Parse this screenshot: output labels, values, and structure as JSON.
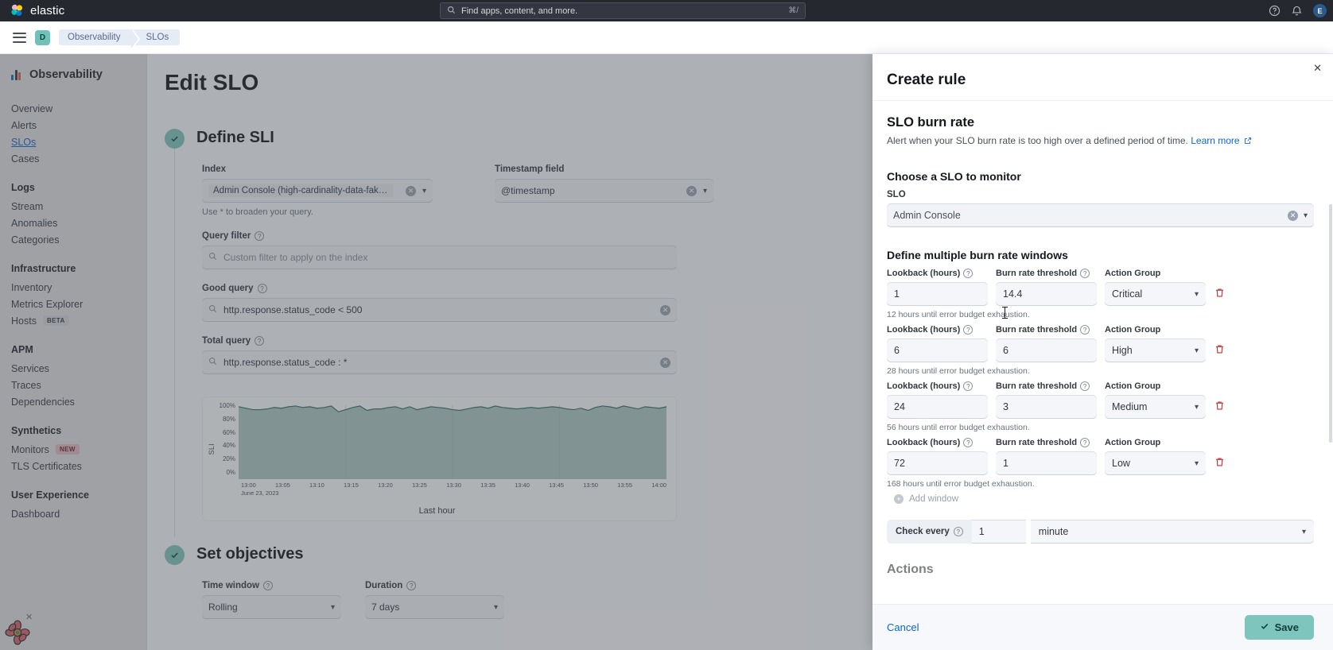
{
  "topbar": {
    "brand": "elastic",
    "search_placeholder": "Find apps, content, and more.",
    "search_kbd": "⌘/",
    "icons": [
      "help-icon",
      "notifications-icon"
    ],
    "avatar_initial": "E"
  },
  "breadcrumb": {
    "space_badge": "D",
    "items": [
      "Observability",
      "SLOs"
    ]
  },
  "sidebar": {
    "title": "Observability",
    "groups": [
      {
        "title": "",
        "items": [
          {
            "label": "Overview",
            "badge": ""
          },
          {
            "label": "Alerts",
            "badge": ""
          },
          {
            "label": "SLOs",
            "badge": "",
            "active": true
          },
          {
            "label": "Cases",
            "badge": ""
          }
        ]
      },
      {
        "title": "Logs",
        "items": [
          {
            "label": "Stream",
            "badge": ""
          },
          {
            "label": "Anomalies",
            "badge": ""
          },
          {
            "label": "Categories",
            "badge": ""
          }
        ]
      },
      {
        "title": "Infrastructure",
        "items": [
          {
            "label": "Inventory",
            "badge": ""
          },
          {
            "label": "Metrics Explorer",
            "badge": ""
          },
          {
            "label": "Hosts",
            "badge": "BETA",
            "badge_kind": "beta"
          }
        ]
      },
      {
        "title": "APM",
        "items": [
          {
            "label": "Services",
            "badge": ""
          },
          {
            "label": "Traces",
            "badge": ""
          },
          {
            "label": "Dependencies",
            "badge": ""
          }
        ]
      },
      {
        "title": "Synthetics",
        "items": [
          {
            "label": "Monitors",
            "badge": "NEW",
            "badge_kind": "new"
          },
          {
            "label": "TLS Certificates",
            "badge": ""
          }
        ]
      },
      {
        "title": "User Experience",
        "items": [
          {
            "label": "Dashboard",
            "badge": ""
          }
        ]
      }
    ]
  },
  "main": {
    "page_title": "Edit SLO",
    "step1": {
      "title": "Define SLI",
      "index_label": "Index",
      "index_value": "Admin Console (high-cardinality-data-fake_stack....",
      "index_hint": "Use * to broaden your query.",
      "timestamp_label": "Timestamp field",
      "timestamp_value": "@timestamp",
      "query_filter_label": "Query filter",
      "query_filter_placeholder": "Custom filter to apply on the index",
      "good_query_label": "Good query",
      "good_query_value": "http.response.status_code < 500",
      "total_query_label": "Total query",
      "total_query_value": "http.response.status_code : *"
    },
    "step2": {
      "title": "Set objectives",
      "time_window_label": "Time window",
      "time_window_value": "Rolling",
      "duration_label": "Duration",
      "duration_value": "7 days"
    }
  },
  "chart_data": {
    "type": "area",
    "title": "",
    "xlabel": "Last hour",
    "ylabel": "SLI",
    "date_label": "June 23, 2023",
    "ylim": [
      0,
      100
    ],
    "ytick_labels": [
      "100%",
      "80%",
      "60%",
      "40%",
      "20%",
      "0%"
    ],
    "ytick_values": [
      100,
      80,
      60,
      40,
      20,
      0
    ],
    "grid": true,
    "legend": "none",
    "line_color": "#2f6f66",
    "fill_color": "#8fb2ac",
    "x": [
      "13:00",
      "13:05",
      "13:10",
      "13:15",
      "13:20",
      "13:25",
      "13:30",
      "13:35",
      "13:40",
      "13:45",
      "13:50",
      "13:55",
      "14:00"
    ],
    "values": [
      98,
      96,
      94,
      94,
      95,
      97,
      96,
      98,
      99,
      97,
      98,
      96,
      97,
      99,
      91,
      94,
      97,
      99,
      93,
      95,
      95,
      97,
      98,
      95,
      98,
      94,
      96,
      98,
      97,
      96,
      94,
      93,
      95,
      97,
      98,
      96,
      99,
      97,
      96,
      95,
      96,
      97,
      96,
      97,
      98,
      97,
      95,
      94,
      96,
      93,
      97,
      99,
      98,
      96,
      99,
      97,
      95,
      98,
      97,
      96,
      98
    ]
  },
  "flyout": {
    "title": "Create rule",
    "close_icon": "close-icon",
    "section": {
      "title": "SLO burn rate",
      "description": "Alert when your SLO burn rate is too high over a defined period of time.",
      "link_text": "Learn more",
      "external_icon": "external-link-icon"
    },
    "choose_slo": {
      "heading": "Choose a SLO to monitor",
      "label": "SLO",
      "value": "Admin Console"
    },
    "windows": {
      "heading": "Define multiple burn rate windows",
      "col_lookback": "Lookback (hours)",
      "col_threshold": "Burn rate threshold",
      "col_action": "Action Group",
      "rows": [
        {
          "lookback": "1",
          "threshold": "14.4",
          "action": "Critical",
          "exhaustion": "12 hours until error budget exhaustion."
        },
        {
          "lookback": "6",
          "threshold": "6",
          "action": "High",
          "exhaustion": "28 hours until error budget exhaustion."
        },
        {
          "lookback": "24",
          "threshold": "3",
          "action": "Medium",
          "exhaustion": "56 hours until error budget exhaustion."
        },
        {
          "lookback": "72",
          "threshold": "1",
          "action": "Low",
          "exhaustion": "168 hours until error budget exhaustion."
        }
      ],
      "add_window": "Add window"
    },
    "check_every": {
      "label": "Check every",
      "value": "1",
      "unit": "minute"
    },
    "actions_heading": "Actions",
    "footer": {
      "cancel": "Cancel",
      "save": "Save"
    }
  },
  "colors": {
    "accent": "#7ec5bd",
    "link": "#0b64dd",
    "danger": "#bd3535",
    "topbar_bg": "#25282f"
  }
}
